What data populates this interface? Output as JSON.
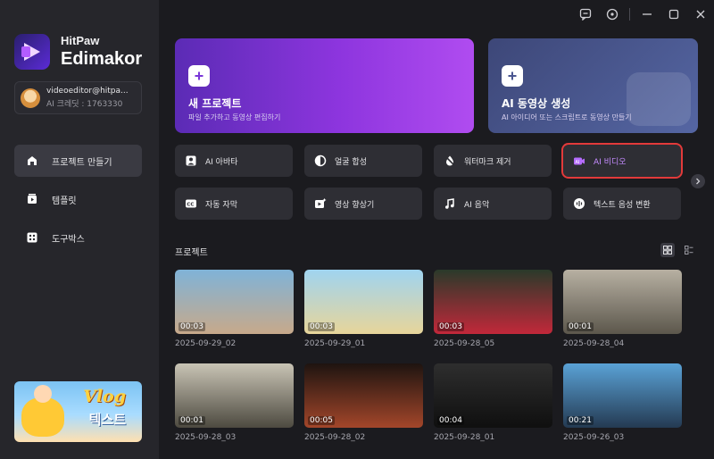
{
  "brand": {
    "line1": "HitPaw",
    "line2": "Edimakor"
  },
  "account": {
    "email": "videoeditor@hitpa...",
    "credits": "AI 크레딧 : 1763330"
  },
  "nav": [
    {
      "label": "프로젝트 만들기",
      "icon": "home-icon",
      "active": true
    },
    {
      "label": "템플릿",
      "icon": "template-icon",
      "active": false
    },
    {
      "label": "도구박스",
      "icon": "toolbox-icon",
      "active": false
    }
  ],
  "promo": {
    "title": "Vlog",
    "subtitle": "텍스트"
  },
  "hero": {
    "new_project": {
      "title": "새 프로젝트",
      "desc": "파일 추가하고 동영상 편집하기"
    },
    "ai_video": {
      "title": "AI 동영상 생성",
      "desc": "AI 아이디어 또는 스크립트로 동영상 만들기"
    }
  },
  "tools": [
    {
      "label": "AI 아바타",
      "icon": "avatar-icon"
    },
    {
      "label": "얼굴 합성",
      "icon": "face-swap-icon"
    },
    {
      "label": "워터마크 제거",
      "icon": "watermark-remove-icon"
    },
    {
      "label": "AI 비디오",
      "icon": "ai-video-icon"
    },
    {
      "label": "자동 자막",
      "icon": "caption-icon"
    },
    {
      "label": "영상 향상기",
      "icon": "enhance-icon"
    },
    {
      "label": "AI 음악",
      "icon": "music-icon"
    },
    {
      "label": "텍스트 음성 변환",
      "icon": "tts-icon"
    }
  ],
  "projects_title": "프로젝트",
  "projects": [
    {
      "duration": "00:03",
      "name": "2025-09-29_02",
      "colors": [
        "#7fb3d8",
        "#c7a98a"
      ]
    },
    {
      "duration": "00:03",
      "name": "2025-09-29_01",
      "colors": [
        "#9fd4f0",
        "#e7d59a"
      ]
    },
    {
      "duration": "00:03",
      "name": "2025-09-28_05",
      "colors": [
        "#2a3a2a",
        "#c2283a"
      ]
    },
    {
      "duration": "00:01",
      "name": "2025-09-28_04",
      "colors": [
        "#b7b0a2",
        "#5c574c"
      ]
    },
    {
      "duration": "00:01",
      "name": "2025-09-28_03",
      "colors": [
        "#c9c4b5",
        "#4d4a40"
      ]
    },
    {
      "duration": "00:05",
      "name": "2025-09-28_02",
      "colors": [
        "#1e1410",
        "#a3462a"
      ]
    },
    {
      "duration": "00:04",
      "name": "2025-09-28_01",
      "colors": [
        "#2e2e2e",
        "#0f0f0f"
      ]
    },
    {
      "duration": "00:21",
      "name": "2025-09-26_03",
      "colors": [
        "#5aa2d6",
        "#243a52"
      ]
    }
  ],
  "colors": {
    "accent": "#a855f7",
    "highlight": "#e23a3a",
    "bg": "#1b1b1f",
    "sidebar": "#26262b"
  }
}
